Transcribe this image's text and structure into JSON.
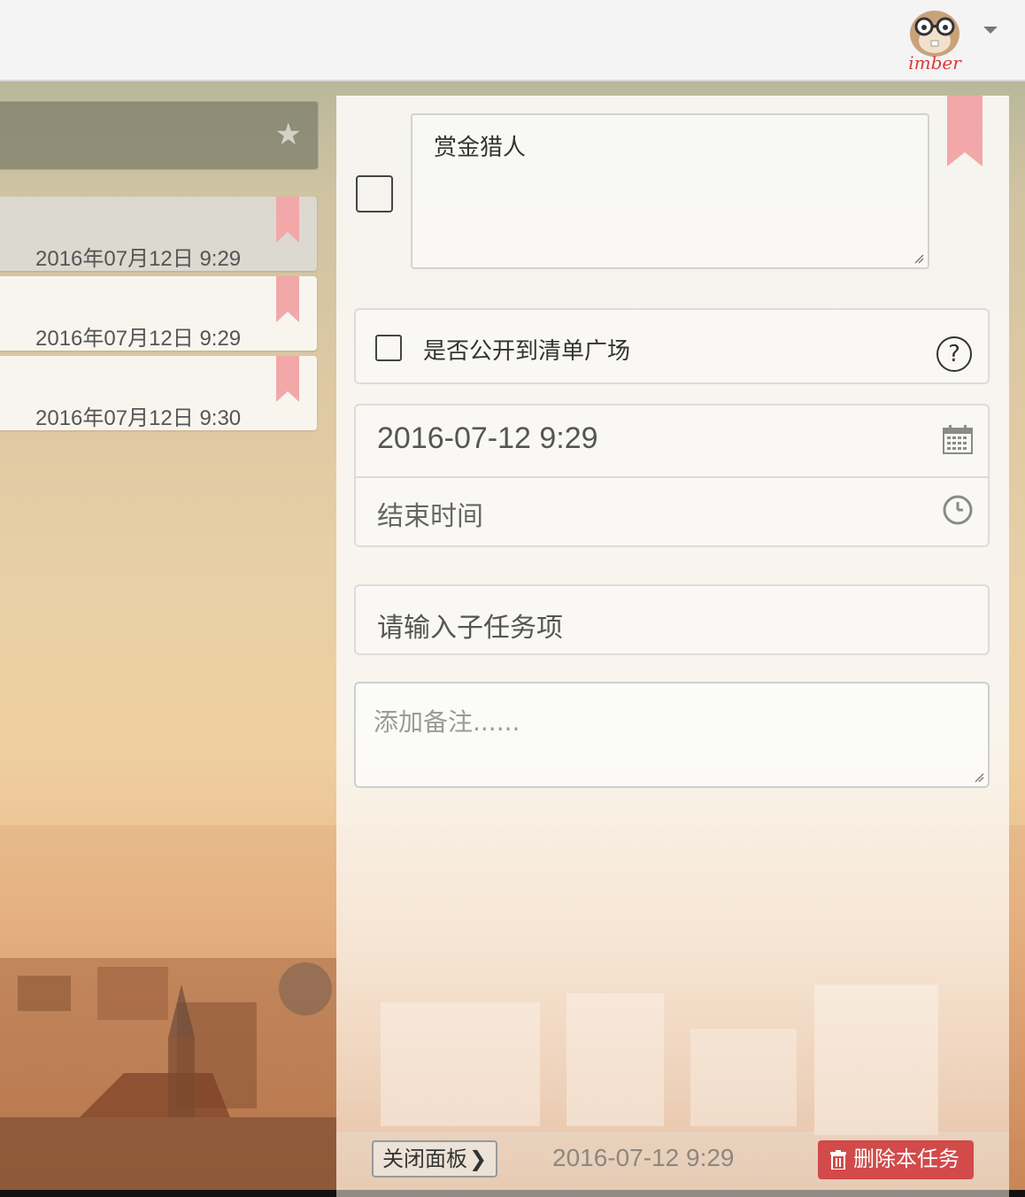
{
  "colors": {
    "ribbon": "#f2a8a8",
    "delete": "#d24a4a",
    "accent_text": "#333333"
  },
  "icons": {
    "logo": "hamster-mascot-logo",
    "header_star": "star-icon",
    "calendar": "calendar-icon",
    "clock": "clock-icon",
    "help": "question-icon",
    "trash": "trash-icon",
    "close_chevron": "chevron-right-icon"
  },
  "topbar": {
    "logo_text": "imber",
    "dropdown_caret": "caret-down-icon"
  },
  "list": {
    "header_star": "★",
    "tasks": [
      {
        "date": "2016年07月12日 9:29",
        "selected": true
      },
      {
        "date": "2016年07月12日 9:29",
        "selected": false
      },
      {
        "date": "2016年07月12日 9:30",
        "selected": false
      }
    ]
  },
  "detail": {
    "title": "赏金猎人",
    "public_label": "是否公开到清单广场",
    "help_symbol": "?",
    "start_time": "2016-07-12 9:29",
    "end_time_placeholder": "结束时间",
    "subtask_placeholder": "请输入子任务项",
    "note_placeholder": "添加备注......"
  },
  "footer": {
    "close_label": "关闭面板",
    "close_chevron": "❯",
    "created_date": "2016-07-12 9:29",
    "delete_label": "删除本任务"
  }
}
